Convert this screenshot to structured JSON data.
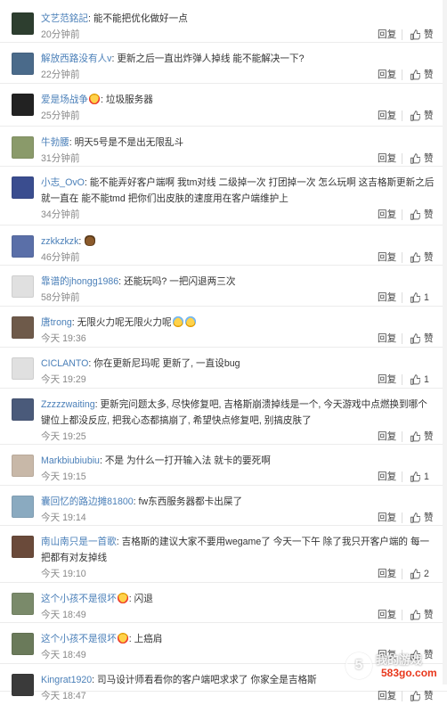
{
  "reply_label": "回复",
  "like_label": "赞",
  "comments": [
    {
      "user": "文艺范銘記",
      "text": "能不能把优化做好一点",
      "emoji": [],
      "time": "20分钟前",
      "likes": "赞",
      "avatar_color": "#2d3e2f"
    },
    {
      "user": "解放西路没有人v",
      "text": "更新之后一直出炸弹人掉线 能不能解决一下?",
      "emoji": [],
      "time": "22分钟前",
      "likes": "赞",
      "avatar_color": "#4a6a8a"
    },
    {
      "user": "爱是场战争",
      "text": "垃圾服务器",
      "emoji": [
        "heart-eyes"
      ],
      "time": "25分钟前",
      "likes": "赞",
      "avatar_color": "#222222"
    },
    {
      "user": "牛勃腰",
      "text": "明天5号是不是出无限乱斗",
      "emoji": [],
      "time": "31分钟前",
      "likes": "赞",
      "avatar_color": "#8a9a6a"
    },
    {
      "user": "小志_OvO",
      "text": "能不能弄好客户端啊 我tm对线 二级掉一次 打团掉一次 怎么玩啊 这吉格斯更新之后就一直在 能不能tmd 把你们出皮肤的速度用在客户端维护上",
      "emoji": [],
      "time": "34分钟前",
      "likes": "赞",
      "avatar_color": "#3a4d8f"
    },
    {
      "user": "zzkkzkzk",
      "text": "",
      "emoji": [
        "bear"
      ],
      "time": "46分钟前",
      "likes": "赞",
      "avatar_color": "#5a6fa8"
    },
    {
      "user": "靠谱的jhongg1986",
      "text": "还能玩吗? 一把闪退两三次",
      "emoji": [],
      "time": "58分钟前",
      "likes": "1",
      "avatar_color": "#e0e0e0"
    },
    {
      "user": "唐trong",
      "text": "无限火力呢无限火力呢",
      "emoji": [
        "crying",
        "crying"
      ],
      "time": "今天 19:36",
      "likes": "赞",
      "avatar_color": "#6e5a4a"
    },
    {
      "user": "CICLANTO",
      "text": "你在更新尼玛呢 更新了, 一直设bug",
      "emoji": [],
      "time": "今天 19:29",
      "likes": "1",
      "avatar_color": "#e0e0e0"
    },
    {
      "user": "Zzzzzwaiting",
      "text": "更新完问题太多, 尽快修复吧, 吉格斯崩溃掉线是一个, 今天游戏中点燃换到哪个键位上都没反应, 把我心态都搞崩了, 希望快点修复吧, 别搞皮肤了",
      "emoji": [],
      "time": "今天 19:25",
      "likes": "赞",
      "avatar_color": "#4a5a7a"
    },
    {
      "user": "Markbiubiubiu",
      "text": "不是 为什么一打开输入法 就卡的要死啊",
      "emoji": [],
      "time": "今天 19:15",
      "likes": "1",
      "avatar_color": "#c8b8a8"
    },
    {
      "user": "囊回忆的路边摊81800",
      "text": "fw东西服务器都卡出屎了",
      "emoji": [],
      "time": "今天 19:14",
      "likes": "赞",
      "avatar_color": "#8aaac0"
    },
    {
      "user": "南山南只是一首歌",
      "text": "吉格斯的建议大家不要用wegame了 今天一下午 除了我只开客户端的 每一把都有对友掉线",
      "emoji": [],
      "time": "今天 19:10",
      "likes": "2",
      "avatar_color": "#6a4a3a"
    },
    {
      "user": "这个小孩不是很坏",
      "text": "闪退",
      "emoji": [
        "heart-eyes"
      ],
      "time": "今天 18:49",
      "likes": "赞",
      "avatar_color": "#7a8a6a"
    },
    {
      "user": "这个小孩不是很坏",
      "text": "上癌肩",
      "emoji": [
        "heart-eyes"
      ],
      "time": "今天 18:49",
      "likes": "赞",
      "avatar_color": "#6a7a5a"
    },
    {
      "user": "Kingrat1920",
      "text": "司马设计师看看你的客户端吧求求了 你家全是吉格斯",
      "emoji": [],
      "time": "今天 18:47",
      "likes": "赞",
      "avatar_color": "#3a3a3a"
    }
  ],
  "watermark": {
    "mark": "5",
    "text": "我的游戏",
    "site": "583go.com"
  }
}
